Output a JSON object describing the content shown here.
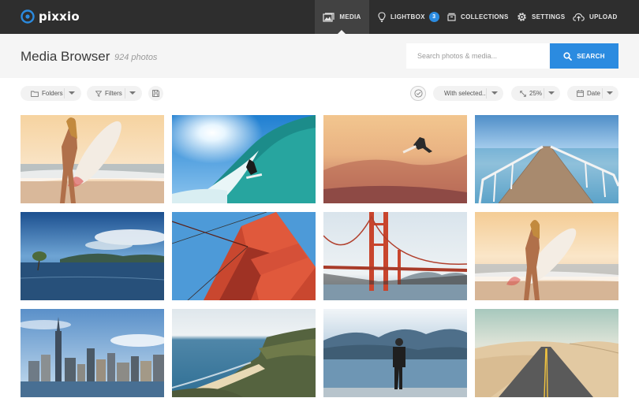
{
  "brand": {
    "name": "pixxio",
    "color": "#2b8be0"
  },
  "nav": {
    "media": "MEDIA",
    "lightbox": "LIGHTBOX",
    "lightbox_count": "3",
    "collections": "COLLECTIONS",
    "settings": "SETTINGS",
    "upload": "UPLOAD"
  },
  "header": {
    "title": "Media Browser",
    "count": "924 photos"
  },
  "search": {
    "placeholder": "Search photos & media...",
    "button": "SEARCH"
  },
  "toolbar": {
    "folders": "Folders",
    "filters": "Filters",
    "with_selected": "With selected...",
    "zoom": "25%",
    "sort": "Date"
  },
  "photos": [
    {
      "subject": "surfer-woman-beach"
    },
    {
      "subject": "surfer-wave-barrel"
    },
    {
      "subject": "surfer-aerial-sunset"
    },
    {
      "subject": "wooden-pier"
    },
    {
      "subject": "lake-tree-clouds"
    },
    {
      "subject": "golden-gate-tower-closeup"
    },
    {
      "subject": "golden-gate-bridge"
    },
    {
      "subject": "surfer-woman-beach-2"
    },
    {
      "subject": "city-skyline"
    },
    {
      "subject": "coastline-cliffs"
    },
    {
      "subject": "man-at-fjord"
    },
    {
      "subject": "desert-road"
    }
  ]
}
